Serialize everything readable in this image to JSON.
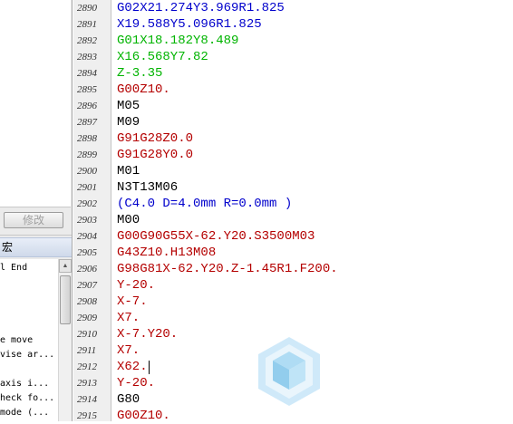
{
  "left_panel": {
    "modify_button_label": "修改",
    "macro_header_label": "宏",
    "macro_items": [
      "l End",
      "",
      "",
      "",
      "",
      "e move",
      "vise ar...",
      "",
      "axis i...",
      "heck fo...",
      "mode (..."
    ]
  },
  "editor": {
    "lines": [
      {
        "num": "2890",
        "code": "G02X21.274Y3.969R1.825",
        "color": "#0000cc"
      },
      {
        "num": "2891",
        "code": "X19.588Y5.096R1.825",
        "color": "#0000cc"
      },
      {
        "num": "2892",
        "code": "G01X18.182Y8.489",
        "color": "#00b400"
      },
      {
        "num": "2893",
        "code": "X16.568Y7.82",
        "color": "#00b400"
      },
      {
        "num": "2894",
        "code": "Z-3.35",
        "color": "#00b400"
      },
      {
        "num": "2895",
        "code": "G00Z10.",
        "color": "#b40000"
      },
      {
        "num": "2896",
        "code": "M05",
        "color": "#000000"
      },
      {
        "num": "2897",
        "code": "M09",
        "color": "#000000"
      },
      {
        "num": "2898",
        "code": "G91G28Z0.0",
        "color": "#b40000"
      },
      {
        "num": "2899",
        "code": "G91G28Y0.0",
        "color": "#b40000"
      },
      {
        "num": "2900",
        "code": "M01",
        "color": "#000000"
      },
      {
        "num": "2901",
        "code": "N3T13M06",
        "color": "#000000"
      },
      {
        "num": "2902",
        "code": "(C4.0 D=4.0mm R=0.0mm )",
        "color": "#0000cc"
      },
      {
        "num": "2903",
        "code": "M00",
        "color": "#000000"
      },
      {
        "num": "2904",
        "code": "G00G90G55X-62.Y20.S3500M03",
        "color": "#b40000"
      },
      {
        "num": "2905",
        "code": "G43Z10.H13M08",
        "color": "#b40000"
      },
      {
        "num": "2906",
        "code": "G98G81X-62.Y20.Z-1.45R1.F200.",
        "color": "#b40000"
      },
      {
        "num": "2907",
        "code": "Y-20.",
        "color": "#b40000"
      },
      {
        "num": "2908",
        "code": "X-7.",
        "color": "#b40000"
      },
      {
        "num": "2909",
        "code": "X7.",
        "color": "#b40000"
      },
      {
        "num": "2910",
        "code": "X-7.Y20.",
        "color": "#b40000"
      },
      {
        "num": "2911",
        "code": "X7.",
        "color": "#b40000"
      },
      {
        "num": "2912",
        "code": "X62.",
        "color": "#b40000"
      },
      {
        "num": "2913",
        "code": "Y-20.",
        "color": "#b40000"
      },
      {
        "num": "2914",
        "code": "G80",
        "color": "#000000"
      },
      {
        "num": "2915",
        "code": "G00Z10.",
        "color": "#b40000"
      }
    ],
    "cursor_line_index": 22
  }
}
